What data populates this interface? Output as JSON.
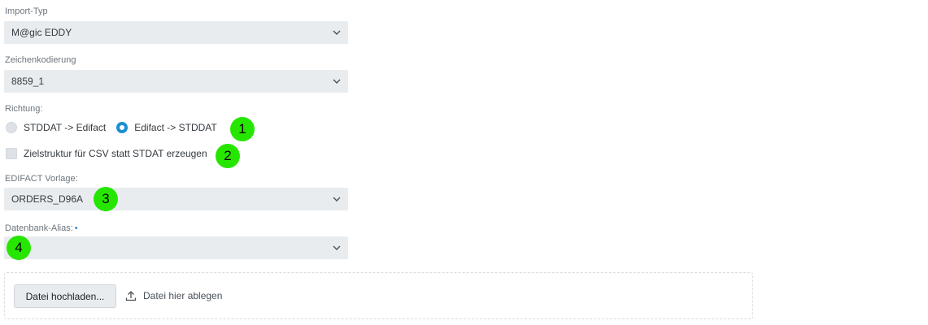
{
  "import_type": {
    "label": "Import-Typ",
    "value": "M@gic EDDY",
    "icon": "chevron-down-icon"
  },
  "encoding": {
    "label": "Zeichenkodierung",
    "value": "8859_1",
    "icon": "chevron-down-icon"
  },
  "direction": {
    "label": "Richtung:",
    "options": [
      {
        "label": "STDDAT -> Edifact",
        "selected": false
      },
      {
        "label": "Edifact -> STDDAT",
        "selected": true
      }
    ]
  },
  "csv_target": {
    "label": "Zielstruktur für CSV statt STDAT erzeugen",
    "checked": false
  },
  "edifact_template": {
    "label": "EDIFACT Vorlage:",
    "value": "ORDERS_D96A",
    "icon": "chevron-down-icon"
  },
  "db_alias": {
    "label": "Datenbank-Alias:",
    "required_marker": "•",
    "value": "",
    "icon": "chevron-down-icon"
  },
  "upload": {
    "button_label": "Datei hochladen...",
    "drop_label": "Datei hier ablegen",
    "icon": "upload-icon"
  },
  "annotations": [
    "1",
    "2",
    "3",
    "4"
  ],
  "colors": {
    "accent": "#1a8fd2",
    "annotation": "#26e600",
    "field_bg": "#e9ecef"
  }
}
